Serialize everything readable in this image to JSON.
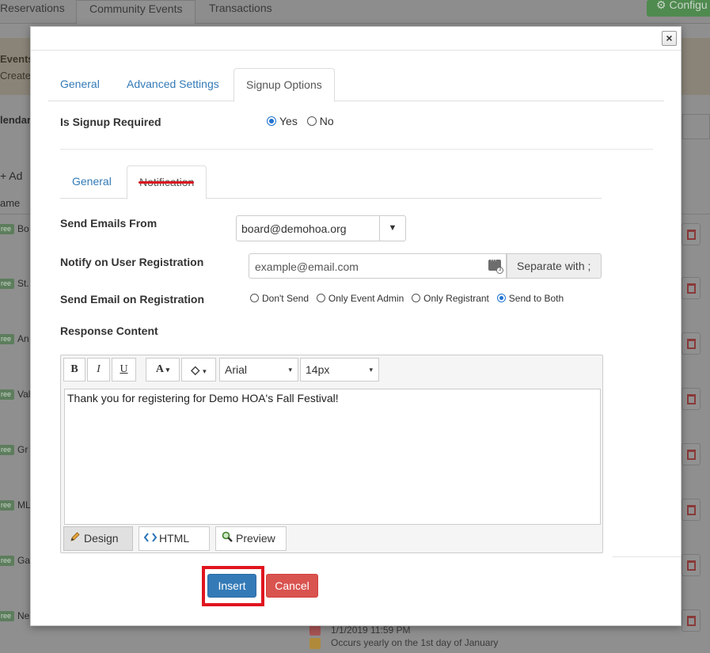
{
  "background": {
    "tabs": [
      "Reservations",
      "Community Events",
      "Transactions"
    ],
    "configure_label": "Configu",
    "banner_title": "Events",
    "banner_sub": "Create",
    "calendar_label": "lendar",
    "add_label": "+ Ad",
    "name_header": "ame",
    "rows": [
      {
        "badge": "ree",
        "text": "Bo"
      },
      {
        "badge": "ree",
        "text": "St."
      },
      {
        "badge": "ree",
        "text": "An"
      },
      {
        "badge": "ree",
        "text": "Val"
      },
      {
        "badge": "ree",
        "text": "Gr"
      },
      {
        "badge": "ree",
        "text": "ML"
      },
      {
        "badge": "ree",
        "text": "Ga"
      },
      {
        "badge": "ree",
        "text": "Ne"
      }
    ],
    "bottom_date": "1/1/2019 11:59 PM",
    "bottom_recurrence": "Occurs yearly on the 1st day of January"
  },
  "modal": {
    "close_symbol": "×",
    "tabs": [
      {
        "label": "General"
      },
      {
        "label": "Advanced Settings"
      },
      {
        "label": "Signup Options"
      }
    ],
    "signup_required": {
      "label": "Is Signup Required",
      "options": [
        "Yes",
        "No"
      ],
      "selected": "Yes"
    },
    "sub_tabs": [
      {
        "label": "General"
      },
      {
        "label": "Notification"
      }
    ],
    "send_emails_from": {
      "label": "Send Emails From",
      "value": "board@demohoa.org",
      "arrow": "▼"
    },
    "notify_registration": {
      "label": "Notify on User Registration",
      "placeholder": "example@email.com",
      "contact_badge": "3",
      "separator_button": "Separate with ;"
    },
    "send_email_registration": {
      "label": "Send Email on Registration",
      "options": [
        "Don't Send",
        "Only Event Admin",
        "Only Registrant",
        "Send to Both"
      ],
      "selected": "Send to Both"
    },
    "response_content": {
      "label": "Response Content",
      "toolbar": {
        "bold": "B",
        "italic": "I",
        "underline": "U",
        "font_color": "A",
        "highlight": "◇",
        "dropdown_arrow": "▾",
        "font": "Arial",
        "size": "14px"
      },
      "body": "Thank you for registering for Demo HOA's Fall Festival!",
      "modes": [
        "Design",
        "HTML",
        "Preview"
      ],
      "active_mode": "Design"
    },
    "buttons": {
      "insert": "Insert",
      "cancel": "Cancel"
    }
  }
}
